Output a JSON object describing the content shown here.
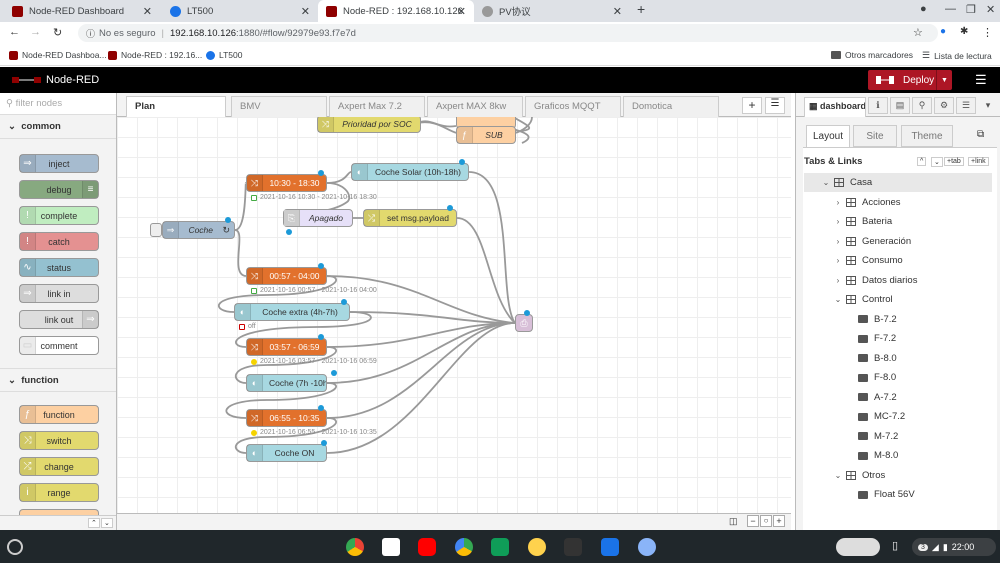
{
  "browser": {
    "tabs": [
      {
        "title": "Node-RED Dashboard",
        "active": false
      },
      {
        "title": "LT500",
        "active": false
      },
      {
        "title": "Node-RED : 192.168.10.126",
        "active": true
      },
      {
        "title": "PV协议",
        "active": false
      }
    ],
    "security": "No es seguro",
    "url_host": "192.168.10.126",
    "url_rest": ":1880/#flow/92979e93.f7e7d",
    "bookmarks": [
      "Node-RED Dashboa...",
      "Node-RED : 192.16...",
      "LT500"
    ],
    "other_bookmarks": "Otros marcadores",
    "reading_list": "Lista de lectura"
  },
  "header": {
    "title": "Node-RED",
    "deploy_label": "Deploy"
  },
  "palette": {
    "filter_placeholder": "filter nodes",
    "categories": [
      "common",
      "function"
    ],
    "common_nodes": [
      "inject",
      "debug",
      "complete",
      "catch",
      "status",
      "link in",
      "link out",
      "comment"
    ],
    "function_nodes": [
      "function",
      "switch",
      "change",
      "range"
    ]
  },
  "workspace": {
    "tabs": [
      "Plan",
      "BMV",
      "Axpert Max 7.2",
      "Axpert MAX 8kw",
      "Graficos MQQT",
      "Domotica"
    ],
    "nodes": {
      "prioridad": "Prioridad por SOC",
      "sub": "SUB",
      "t1030": "10:30 - 18:30",
      "coche_solar": "Coche Solar (10h-18h)",
      "apagado": "Apagado",
      "set_payload": "set msg.payload",
      "coche": "Coche",
      "t0057": "00:57 - 04:00",
      "coche_extra": "Coche extra (4h-7h)",
      "t0357": "03:57 - 06:59",
      "coche_7h": "Coche (7h -10h)",
      "t0655": "06:55 - 10:35",
      "coche_on": "Coche ON"
    },
    "status": {
      "s1030": "2021-10-16 10:30 - 2021-10-16 18:30",
      "s0057": "2021-10-16 00:57 - 2021-10-16 04:00",
      "off": "off",
      "s0357": "2021-10-16 03:57 - 2021-10-16 06:59",
      "s0655": "2021-10-16 06:55 - 2021-10-16 10:35"
    }
  },
  "sidebar": {
    "active_tab": "dashboard",
    "layout_tabs": [
      "Layout",
      "Site",
      "Theme"
    ],
    "section_title": "Tabs & Links",
    "tab_button": "+tab",
    "link_button": "+link",
    "tree": [
      {
        "label": "Casa",
        "level": 0,
        "type": "tab",
        "expanded": true
      },
      {
        "label": "Acciones",
        "level": 1,
        "type": "group"
      },
      {
        "label": "Bateria",
        "level": 1,
        "type": "group"
      },
      {
        "label": "Generación",
        "level": 1,
        "type": "group"
      },
      {
        "label": "Consumo",
        "level": 1,
        "type": "group"
      },
      {
        "label": "Datos diarios",
        "level": 1,
        "type": "group"
      },
      {
        "label": "Control",
        "level": 1,
        "type": "group",
        "expanded": true
      },
      {
        "label": "B-7.2",
        "level": 2,
        "type": "widget"
      },
      {
        "label": "F-7.2",
        "level": 2,
        "type": "widget"
      },
      {
        "label": "B-8.0",
        "level": 2,
        "type": "widget"
      },
      {
        "label": "F-8.0",
        "level": 2,
        "type": "widget"
      },
      {
        "label": "A-7.2",
        "level": 2,
        "type": "widget"
      },
      {
        "label": "MC-7.2",
        "level": 2,
        "type": "widget"
      },
      {
        "label": "M-7.2",
        "level": 2,
        "type": "widget"
      },
      {
        "label": "M-8.0",
        "level": 2,
        "type": "widget"
      },
      {
        "label": "Otros",
        "level": 1,
        "type": "group",
        "expanded": true
      },
      {
        "label": "Float 56V",
        "level": 2,
        "type": "widget"
      }
    ]
  },
  "taskbar": {
    "time": "22:00",
    "notifications": "3"
  },
  "colors": {
    "deploy": "#ad1625",
    "header": "#000000",
    "inject": "#a6bbcf",
    "function": "#fdd0a2",
    "switch": "#e2d96e",
    "timer": "#e2712c",
    "ui": "#a7d8e1"
  }
}
